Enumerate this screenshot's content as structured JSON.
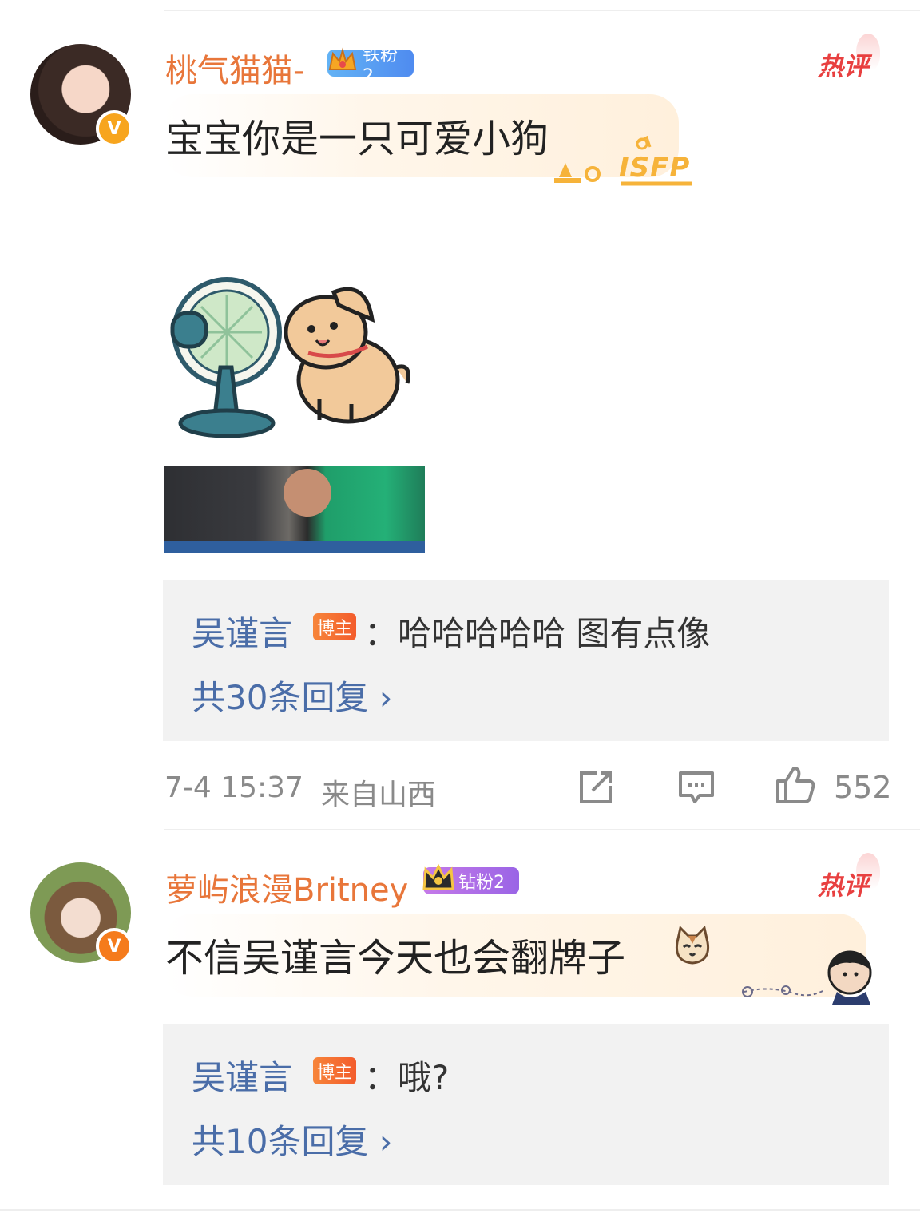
{
  "comments": [
    {
      "username": "桃气猫猫-",
      "fan_badge": "铁粉2",
      "hot_label": "热评",
      "text": "宝宝你是一只可爱小狗",
      "bubble_tag": "ISFP",
      "reply_author": "吴谨言",
      "reply_badge": "博主",
      "reply_text": "：哈哈哈哈哈 图有点像",
      "reply_count": "共30条回复 ›",
      "timestamp": "7-4 15:37",
      "location": "来自山西",
      "like_count": "552"
    },
    {
      "username": "萝屿浪漫Britney",
      "fan_badge": "钻粉2",
      "hot_label": "热评",
      "text": "不信吴谨言今天也会翻牌子",
      "reply_author": "吴谨言",
      "reply_badge": "博主",
      "reply_text": "：哦?",
      "reply_count": "共10条回复 ›"
    }
  ],
  "icons": [
    "verified-icon",
    "crown-icon",
    "share-icon",
    "comment-icon",
    "like-icon",
    "chevron-right-icon"
  ],
  "colors": {
    "username": "#e8763a",
    "link_blue": "#4a6da8",
    "hot_red": "#e84040",
    "reply_bg": "#f2f2f2"
  }
}
